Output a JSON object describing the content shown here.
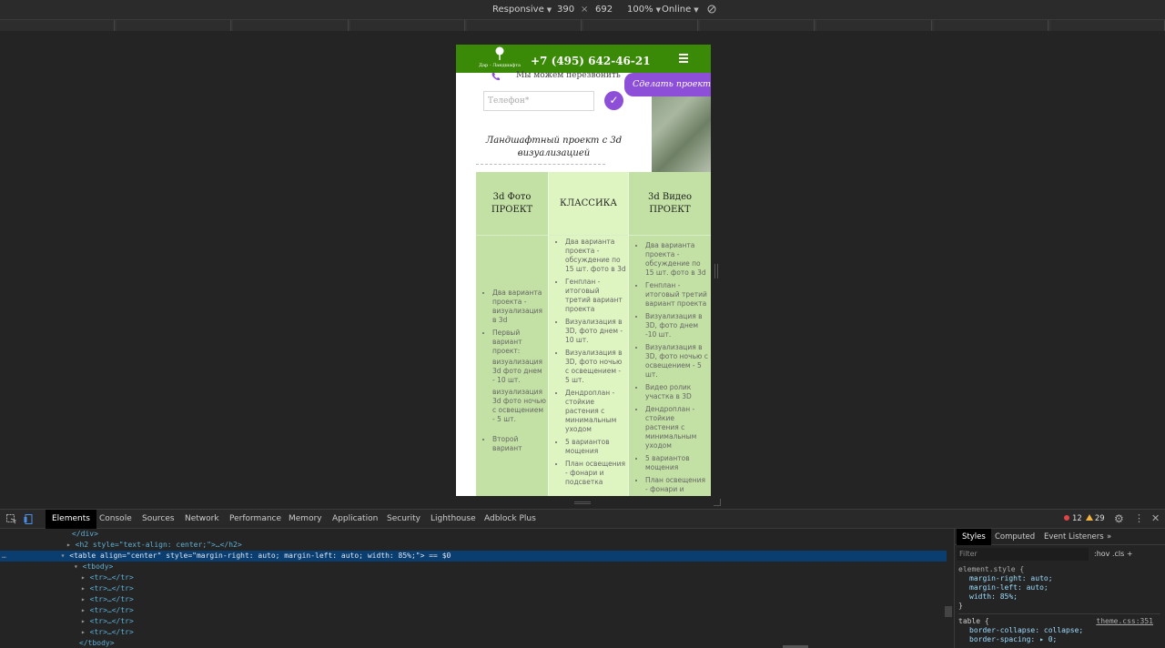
{
  "device_toolbar": {
    "device": "Responsive",
    "width": "390",
    "times": "×",
    "height": "692",
    "zoom": "100%",
    "network": "Online"
  },
  "site": {
    "phone": "+7 (495) 642-46-21",
    "logo_text": "Дар - Ландшафта",
    "callback_text": "Мы можем перезвонить",
    "project_button": "Сделать проект",
    "phone_placeholder": "Телефон*",
    "submit_symbol": "✓",
    "section_title": "Ландшафтный проект с 3d визуализацией",
    "columns": [
      {
        "title": "3d Фото ПРОЕКТ",
        "items": [
          "Два варианта проекта - визуализация в 3d",
          "Первый вариант проект:",
          "визуализация 3d фото днем - 10 шт.",
          "визуализация 3d фото ночью с освещением - 5 шт.",
          "Второй вариант"
        ]
      },
      {
        "title": "КЛАССИКА",
        "items": [
          "Два варианта проекта - обсуждение по 15 шт. фото в 3d",
          "Генплан - итоговый третий вариант проекта",
          "Визуализация в 3D, фото днем - 10 шт.",
          "Визуализация в 3D, фото ночью с освещением - 5 шт.",
          "Дендроплан - стойкие растения с минимальным уходом",
          "5 вариантов мощения",
          "План освещения - фонари и подсветка"
        ]
      },
      {
        "title": "3d Видео ПРОЕКТ",
        "items": [
          "Два варианта проекта - обсуждение по 15 шт. фото в 3d",
          "Генплан - итоговый третий вариант проекта",
          "Визуализация в 3D, фото днем -10 шт.",
          "Визуализация в 3D, фото ночью с освещением - 5 шт.",
          "Видео ролик участка в 3D",
          "Дендроплан - стойкие растения с минимальным уходом",
          "5 вариантов мощения",
          "План освещения - фонари и"
        ]
      }
    ]
  },
  "devtools": {
    "tabs": [
      "Elements",
      "Console",
      "Sources",
      "Network",
      "Performance",
      "Memory",
      "Application",
      "Security",
      "Lighthouse",
      "Adblock Plus"
    ],
    "active_tab": "Elements",
    "errors": "12",
    "warnings": "29",
    "dom_lines": [
      "</div>",
      "<h2 style=\"text-align: center;\">…</h2>",
      "<table align=\"center\" style=\"margin-right: auto; margin-left: auto; width: 85%;\"> == $0",
      "<tbody>",
      "<tr>…</tr>",
      "<tr>…</tr>",
      "<tr>…</tr>",
      "<tr>…</tr>",
      "<tr>…</tr>",
      "<tr>…</tr>",
      "</tbody>"
    ],
    "styles_tabs": [
      "Styles",
      "Computed",
      "Event Listeners",
      "»"
    ],
    "filter_placeholder": "Filter",
    "filter_opts": ":hov  .cls  +",
    "element_style": {
      "selector": "element.style {",
      "props": [
        "margin-right: auto;",
        "margin-left: auto;",
        "width: 85%;"
      ],
      "close": "}"
    },
    "table_rule": {
      "selector": "table {",
      "source": "theme.css:351",
      "props": [
        "border-collapse: collapse;",
        "border-spacing: ▸ 0;"
      ]
    }
  }
}
